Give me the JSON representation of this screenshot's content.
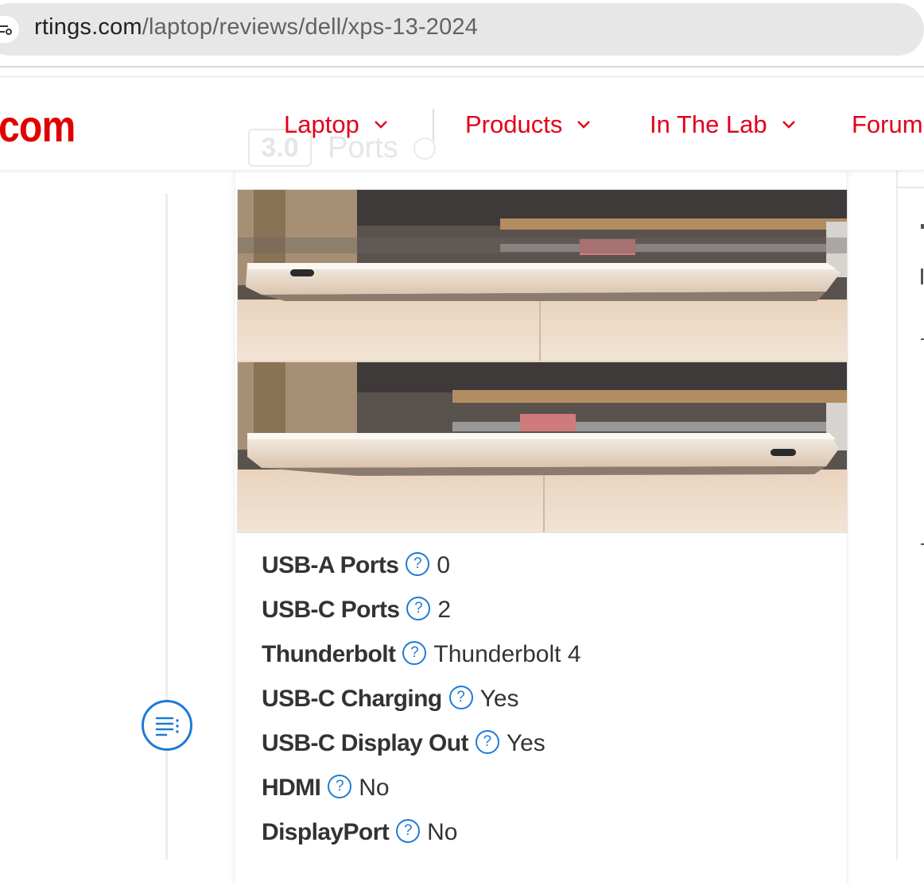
{
  "browser": {
    "url_host": "rtings.com",
    "url_path": "/laptop/reviews/dell/xps-13-2024"
  },
  "header": {
    "logo_text": "com",
    "nav": [
      {
        "label": "Laptop"
      },
      {
        "label": "Products"
      },
      {
        "label": "In The Lab"
      },
      {
        "label": "Forum"
      }
    ],
    "brand_color": "#e2001a"
  },
  "section": {
    "score": "3.0",
    "title": "Ports"
  },
  "specs": [
    {
      "label": "USB-A Ports",
      "value": "0"
    },
    {
      "label": "USB-C Ports",
      "value": "2"
    },
    {
      "label": "Thunderbolt",
      "value": "Thunderbolt 4"
    },
    {
      "label": "USB-C Charging",
      "value": "Yes"
    },
    {
      "label": "USB-C Display Out",
      "value": "Yes"
    },
    {
      "label": "HDMI",
      "value": "No"
    },
    {
      "label": "DisplayPort",
      "value": "No"
    }
  ],
  "icons": {
    "help": "question-circle-icon",
    "toc": "table-of-contents-icon",
    "chevron": "chevron-down-icon"
  },
  "accent_color": "#1e7bd6"
}
